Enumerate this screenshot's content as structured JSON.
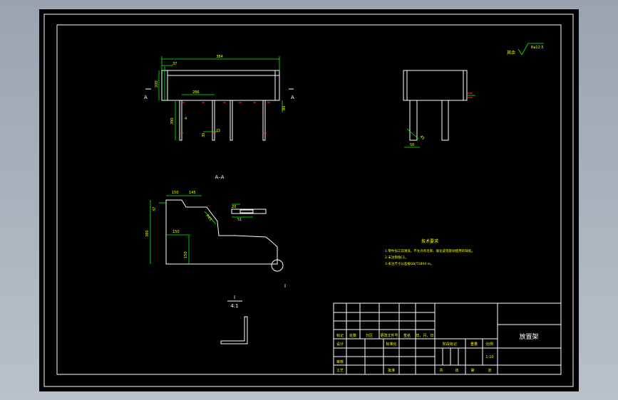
{
  "drawing": {
    "dims": {
      "overall_width": "384",
      "left_offset": "37",
      "inner_span": "286",
      "height_left": "200",
      "height_right": "80",
      "leg_height": "390",
      "leg_gap": "4",
      "leg_small_1": "30",
      "leg_small_2": "15",
      "side_leg_width": "50",
      "side_angle": "45",
      "sec_dim_1": "150",
      "sec_dim_2": "145",
      "sec_dim_3": "37",
      "sec_height": "380",
      "sec_dim_4": "150",
      "sec_dim_5": "150",
      "sec_radius": "R85",
      "slot_dim_1": "20",
      "slot_dim_2": "51"
    },
    "section_marker": "A",
    "section_title": "A–A",
    "detail_marker": "I",
    "detail_scale": "4:1",
    "roughness_prefix": "其余",
    "roughness_value": "Ra12.5",
    "tech_requirements": {
      "title": "技术要求",
      "items": [
        "1.零件加工前清洗，不允许有毛刺、氧化皮等影响使用的缺陷。",
        "2.未注倒角C1。",
        "3.未注尺寸公差按GB/T1804-m。"
      ]
    }
  },
  "title_block": {
    "part_name": "放置架",
    "header_labels": [
      "标记",
      "处数",
      "分区",
      "更改文件号",
      "签名",
      "年、月、日"
    ],
    "row_labels": [
      "设计",
      "标准化"
    ],
    "review_labels": [
      "审核",
      "工艺",
      "批准"
    ],
    "stage_label": "阶段标记",
    "weight_label": "重量",
    "scale_label": "比例",
    "scale_value": "1:10",
    "sheet_labels": [
      "共",
      "张",
      "第",
      "张"
    ]
  }
}
